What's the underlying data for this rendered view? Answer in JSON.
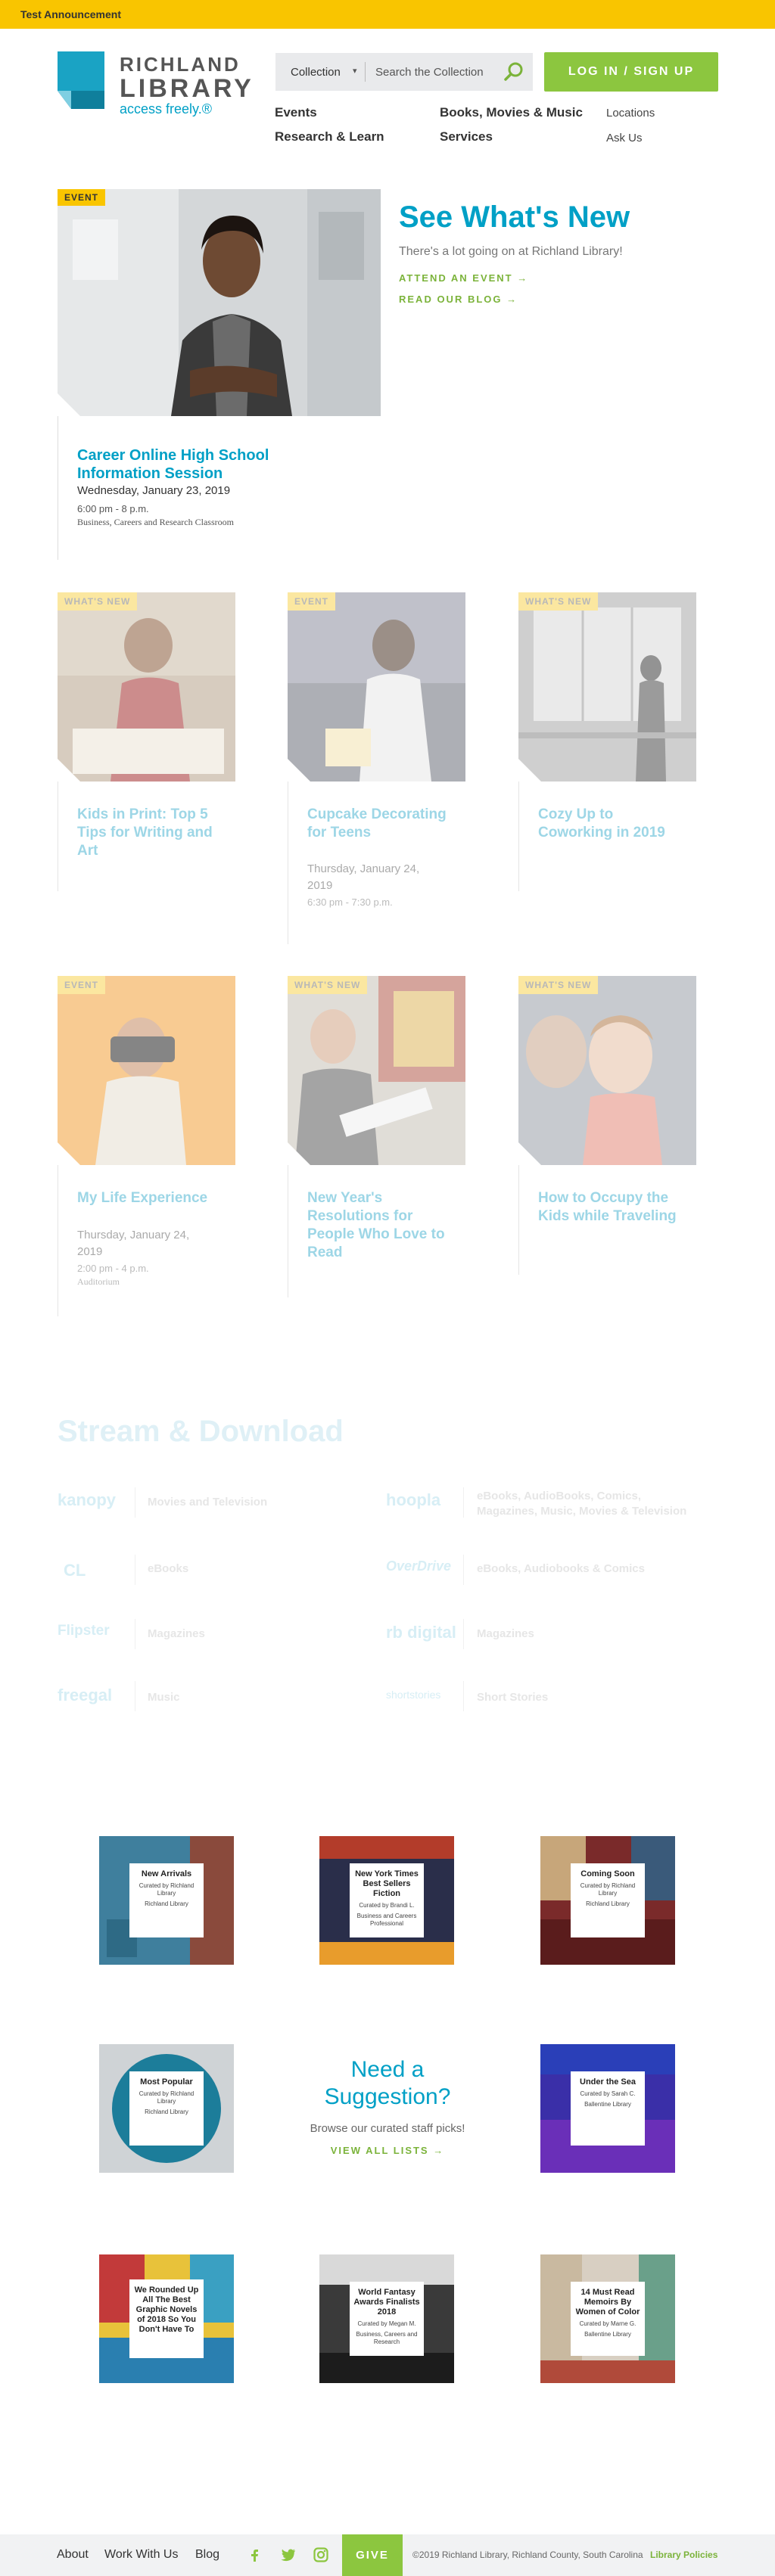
{
  "announcement": "Test Announcement",
  "logo": {
    "line1": "RICHLAND",
    "line2": "LIBRARY",
    "tagline": "access freely.®"
  },
  "search": {
    "scope": "Collection",
    "placeholder": "Search the Collection"
  },
  "login_label": "LOG IN / SIGN UP",
  "nav": {
    "events": "Events",
    "books": "Books, Movies & Music",
    "locations": "Locations",
    "research": "Research & Learn",
    "services": "Services",
    "ask": "Ask Us"
  },
  "feature": {
    "badge": "EVENT",
    "title": "Career Online High School Information Session",
    "date": "Wednesday, January 23, 2019",
    "time": "6:00 pm - 8 p.m.",
    "location": "Business, Careers and Research Classroom"
  },
  "whats_new": {
    "heading": "See What's New",
    "subtitle": "There's a lot going on at Richland Library!",
    "link_event": "ATTEND AN EVENT →",
    "link_blog": "READ OUR BLOG →"
  },
  "cards": [
    {
      "badge": "WHAT'S NEW",
      "title": "Kids in Print: Top 5 Tips for Writing and Art"
    },
    {
      "badge": "EVENT",
      "title": "Cupcake Decorating for Teens",
      "date": "Thursday, January 24, 2019",
      "time": "6:30 pm - 7:30 p.m."
    },
    {
      "badge": "WHAT'S NEW",
      "title": "Cozy Up to Coworking in 2019"
    },
    {
      "badge": "EVENT",
      "title": "My Life Experience",
      "date": "Thursday, January 24, 2019",
      "time": "2:00 pm - 4 p.m.",
      "location": "Auditorium"
    },
    {
      "badge": "WHAT'S NEW",
      "title": "New Year's Resolutions for People Who Love to Read"
    },
    {
      "badge": "WHAT'S NEW",
      "title": "How to Occupy the Kids while Traveling"
    }
  ],
  "stream": {
    "heading": "Stream & Download",
    "services": [
      {
        "name": "kanopy",
        "desc": "Movies and Television"
      },
      {
        "name": "hoopla",
        "desc": "eBooks, AudioBooks, Comics, Magazines, Music, Movies & Television"
      },
      {
        "name": "CL",
        "desc": "eBooks"
      },
      {
        "name": "OverDrive",
        "desc": "eBooks, Audiobooks & Comics"
      },
      {
        "name": "Flipster",
        "desc": "Magazines"
      },
      {
        "name": "rb digital",
        "desc": "Magazines"
      },
      {
        "name": "freegal",
        "desc": "Music"
      },
      {
        "name": "shortstories",
        "desc": "Short Stories"
      }
    ]
  },
  "lists": [
    {
      "title": "New Arrivals",
      "curator": "Curated by Richland Library",
      "branch": "Richland Library"
    },
    {
      "title": "New York Times Best Sellers Fiction",
      "curator": "Curated by Brandi L.",
      "branch": "Business and Careers Professional"
    },
    {
      "title": "Coming Soon",
      "curator": "Curated by Richland Library",
      "branch": "Richland Library"
    },
    {
      "title": "Most Popular",
      "curator": "Curated by Richland Library",
      "branch": "Richland Library"
    },
    {
      "title": "Under the Sea",
      "curator": "Curated by Sarah C.",
      "branch": "Ballentine Library"
    },
    {
      "title": "We Rounded Up All The Best Graphic Novels of 2018 So You Don't Have To",
      "curator": "",
      "branch": ""
    },
    {
      "title": "World Fantasy Awards Finalists 2018",
      "curator": "Curated by Megan M.",
      "branch": "Business, Careers and Research"
    },
    {
      "title": "14 Must Read Memoirs By Women of Color",
      "curator": "Curated by Marne G.",
      "branch": "Ballentine Library"
    }
  ],
  "suggestion": {
    "question": "Need a Suggestion?",
    "desc": "Browse our curated staff picks!",
    "link": "VIEW ALL LISTS →"
  },
  "footer": {
    "about": "About",
    "work": "Work With Us",
    "blog": "Blog",
    "give": "GIVE",
    "copyright": "©2019 Richland Library, Richland County, South Carolina",
    "policies": "Library Policies"
  },
  "colors": {
    "accent": "#00a0c6",
    "green": "#8cc63f",
    "yellow": "#f9c500"
  }
}
